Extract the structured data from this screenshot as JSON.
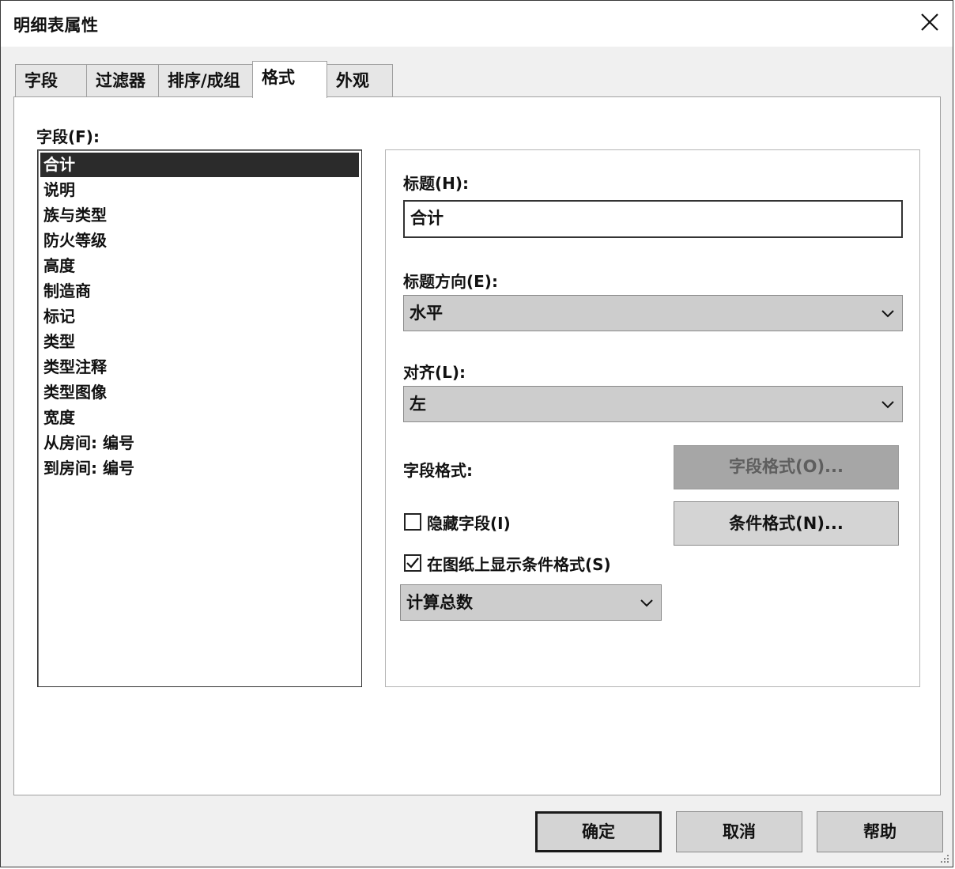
{
  "window": {
    "title": "明细表属性"
  },
  "tabs": [
    {
      "label": "字段"
    },
    {
      "label": "过滤器"
    },
    {
      "label": "排序/成组"
    },
    {
      "label": "格式"
    },
    {
      "label": "外观"
    }
  ],
  "active_tab": "格式",
  "fields": {
    "label": "字段(F):",
    "items": [
      "合计",
      "说明",
      "族与类型",
      "防火等级",
      "高度",
      "制造商",
      "标记",
      "类型",
      "类型注释",
      "类型图像",
      "宽度",
      "从房间: 编号",
      "到房间: 编号"
    ],
    "selected": "合计"
  },
  "format": {
    "heading_label": "标题(H):",
    "heading_value": "合计",
    "orientation_label": "标题方向(E):",
    "orientation_value": "水平",
    "alignment_label": "对齐(L):",
    "alignment_value": "左",
    "field_format_label": "字段格式:",
    "field_format_button": "字段格式(O)...",
    "hide_field_label": "隐藏字段(I)",
    "hide_field_checked": false,
    "conditional_format_button": "条件格式(N)...",
    "show_conditional_label": "在图纸上显示条件格式(S)",
    "show_conditional_checked": true,
    "calculation_value": "计算总数"
  },
  "footer": {
    "ok": "确定",
    "cancel": "取消",
    "help": "帮助"
  }
}
